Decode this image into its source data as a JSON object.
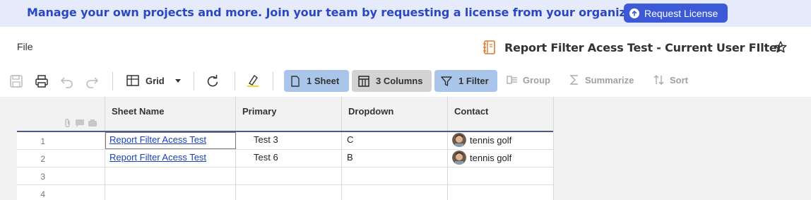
{
  "banner": {
    "message": "Manage your own projects and more. Join your team by requesting a license from your organization.",
    "button_label": "Request License"
  },
  "menu": {
    "file": "File"
  },
  "sheet": {
    "title": "Report Filter Acess Test - Current User FIlter"
  },
  "toolbar": {
    "view_label": "Grid",
    "sheet_pill": "1 Sheet",
    "columns_pill": "3 Columns",
    "filter_pill": "1 Filter",
    "group": "Group",
    "summarize": "Summarize",
    "sort": "Sort"
  },
  "grid": {
    "columns": [
      "Sheet Name",
      "Primary",
      "Dropdown",
      "Contact"
    ],
    "row_numbers": [
      "1",
      "2",
      "3",
      "4"
    ],
    "rows": [
      {
        "sheet_name": "Report Filter Acess Test",
        "primary": "Test 3",
        "dropdown": "C",
        "contact": "tennis golf"
      },
      {
        "sheet_name": "Report Filter Acess Test",
        "primary": "Test 6",
        "dropdown": "B",
        "contact": "tennis golf"
      }
    ]
  },
  "colors": {
    "banner_bg": "#e6ebfb",
    "banner_text": "#2a47c4",
    "accent": "#3c5ad6",
    "pill_blue": "#a9c5ea",
    "pill_gray": "#d3d3d3",
    "link": "#1b3fb8"
  },
  "icons": [
    "info-icon",
    "notebook-icon",
    "star-icon",
    "save-icon",
    "print-icon",
    "undo-icon",
    "redo-icon",
    "grid-view-icon",
    "caret-down-icon",
    "refresh-icon",
    "highlight-icon",
    "sheet-icon",
    "columns-icon",
    "filter-icon",
    "group-icon",
    "summarize-icon",
    "sort-icon",
    "attachment-icon",
    "comment-icon",
    "proof-icon",
    "avatar"
  ]
}
